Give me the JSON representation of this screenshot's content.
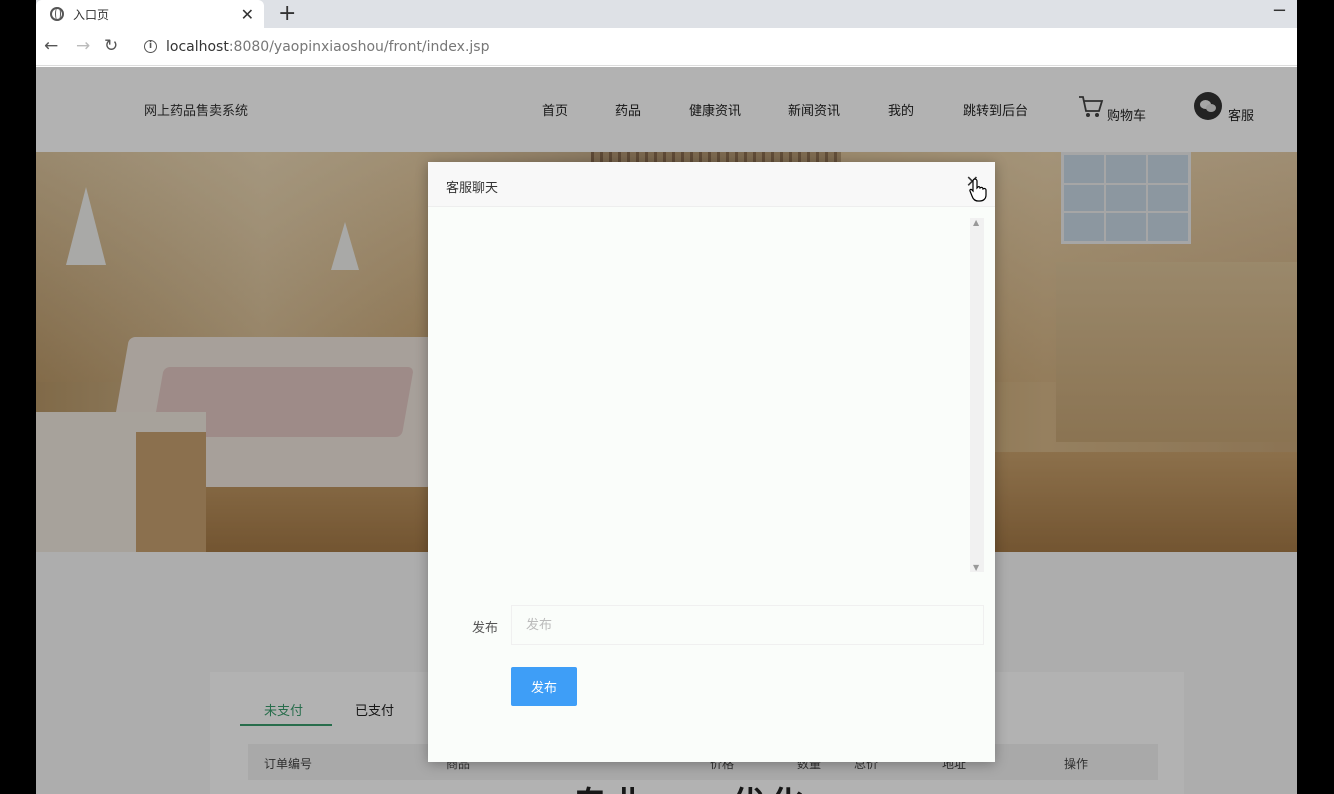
{
  "browser": {
    "tab_title": "入口页",
    "tab_close": "✕",
    "new_tab": "+",
    "minimize": "−",
    "url_host": "localhost",
    "url_rest": ":8080/yaopinxiaoshou/front/index.jsp",
    "back": "←",
    "forward": "→",
    "reload": "↻",
    "info": "i"
  },
  "header": {
    "site_title": "网上药品售卖系统",
    "nav": [
      "首页",
      "药品",
      "健康资讯",
      "新闻资讯",
      "我的",
      "跳转到后台"
    ],
    "cart_label": "购物车",
    "service_label": "客服"
  },
  "orders": {
    "tabs": [
      "未支付",
      "已支付"
    ],
    "columns": [
      "订单编号",
      "商品",
      "价格",
      "数量",
      "总价",
      "地址",
      "操作"
    ],
    "big_title": "专业epa优化"
  },
  "modal": {
    "title": "客服聊天",
    "close": "✕",
    "field_label": "发布",
    "input_placeholder": "发布",
    "input_value": "",
    "send_label": "发布",
    "scroll_up": "▲",
    "scroll_down": "▼"
  },
  "colors": {
    "accent": "#3e9ef7",
    "tab_active": "#3a9d6d"
  }
}
